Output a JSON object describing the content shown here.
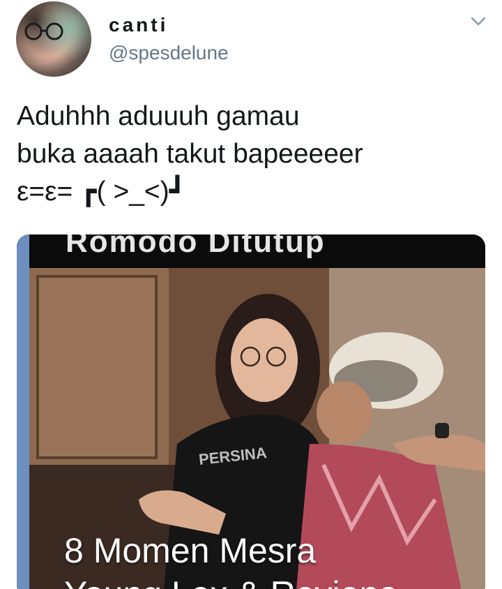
{
  "tweet": {
    "author": {
      "display_name": "canti",
      "handle": "@spesdelune"
    },
    "menu_icon": "chevron-down-icon",
    "text_lines": [
      "Aduhhh aduuuh gamau",
      "buka aaaah takut bapeeeeer",
      "ε=ε= ┏( >_<)┛"
    ]
  },
  "media": {
    "top_text": "Romodo Ditutup",
    "caption_line1": "8 Momen Mesra",
    "caption_line2": "Young Lex & Reviena"
  },
  "colors": {
    "text_primary": "#14171a",
    "text_secondary": "#657786",
    "chevron": "#8899a6",
    "accent_bar": "#6d8fbf"
  }
}
